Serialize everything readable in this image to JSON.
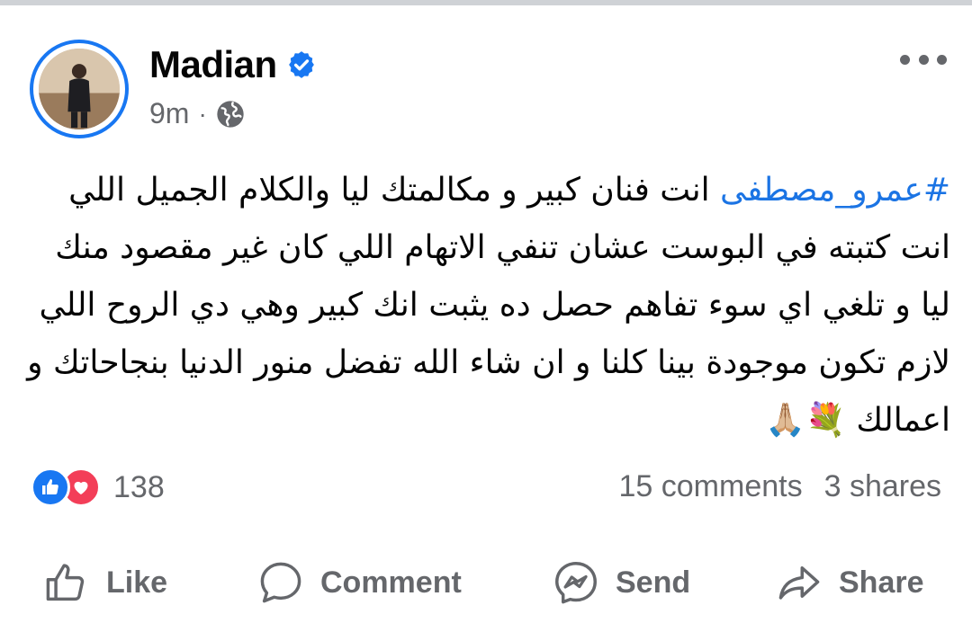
{
  "post": {
    "author": "Madian",
    "time": "9m",
    "meta_separator": "·",
    "hashtag": "#عمرو_مصطفى",
    "text_after_hashtag": " انت فنان كبير و مكالمتك ليا والكلام الجميل اللي انت كتبته في البوست عشان تنفي الاتهام اللي كان غير مقصود منك ليا و تلغي اي سوء تفاهم حصل ده يثبت انك كبير وهي دي الروح اللي لازم تكون موجودة  بينا كلنا و ان شاء الله تفضل منور الدنيا بنجاحاتك و اعمالك 💐🙏🏼"
  },
  "stats": {
    "reaction_count": "138",
    "comments": "15 comments",
    "shares": "3 shares"
  },
  "actions": {
    "like": "Like",
    "comment": "Comment",
    "send": "Send",
    "share": "Share"
  },
  "colors": {
    "accent": "#1877f2",
    "hashtag": "#1b74e4",
    "secondary_text": "#65676b",
    "love": "#f33e58"
  },
  "icons": {
    "verified": "verified-badge-icon",
    "privacy": "globe-icon",
    "more": "more-options-icon",
    "like_reaction": "like-reaction-icon",
    "love_reaction": "love-reaction-icon",
    "like_action": "thumbs-up-icon",
    "comment_action": "comment-bubble-icon",
    "send_action": "messenger-icon",
    "share_action": "share-arrow-icon"
  }
}
